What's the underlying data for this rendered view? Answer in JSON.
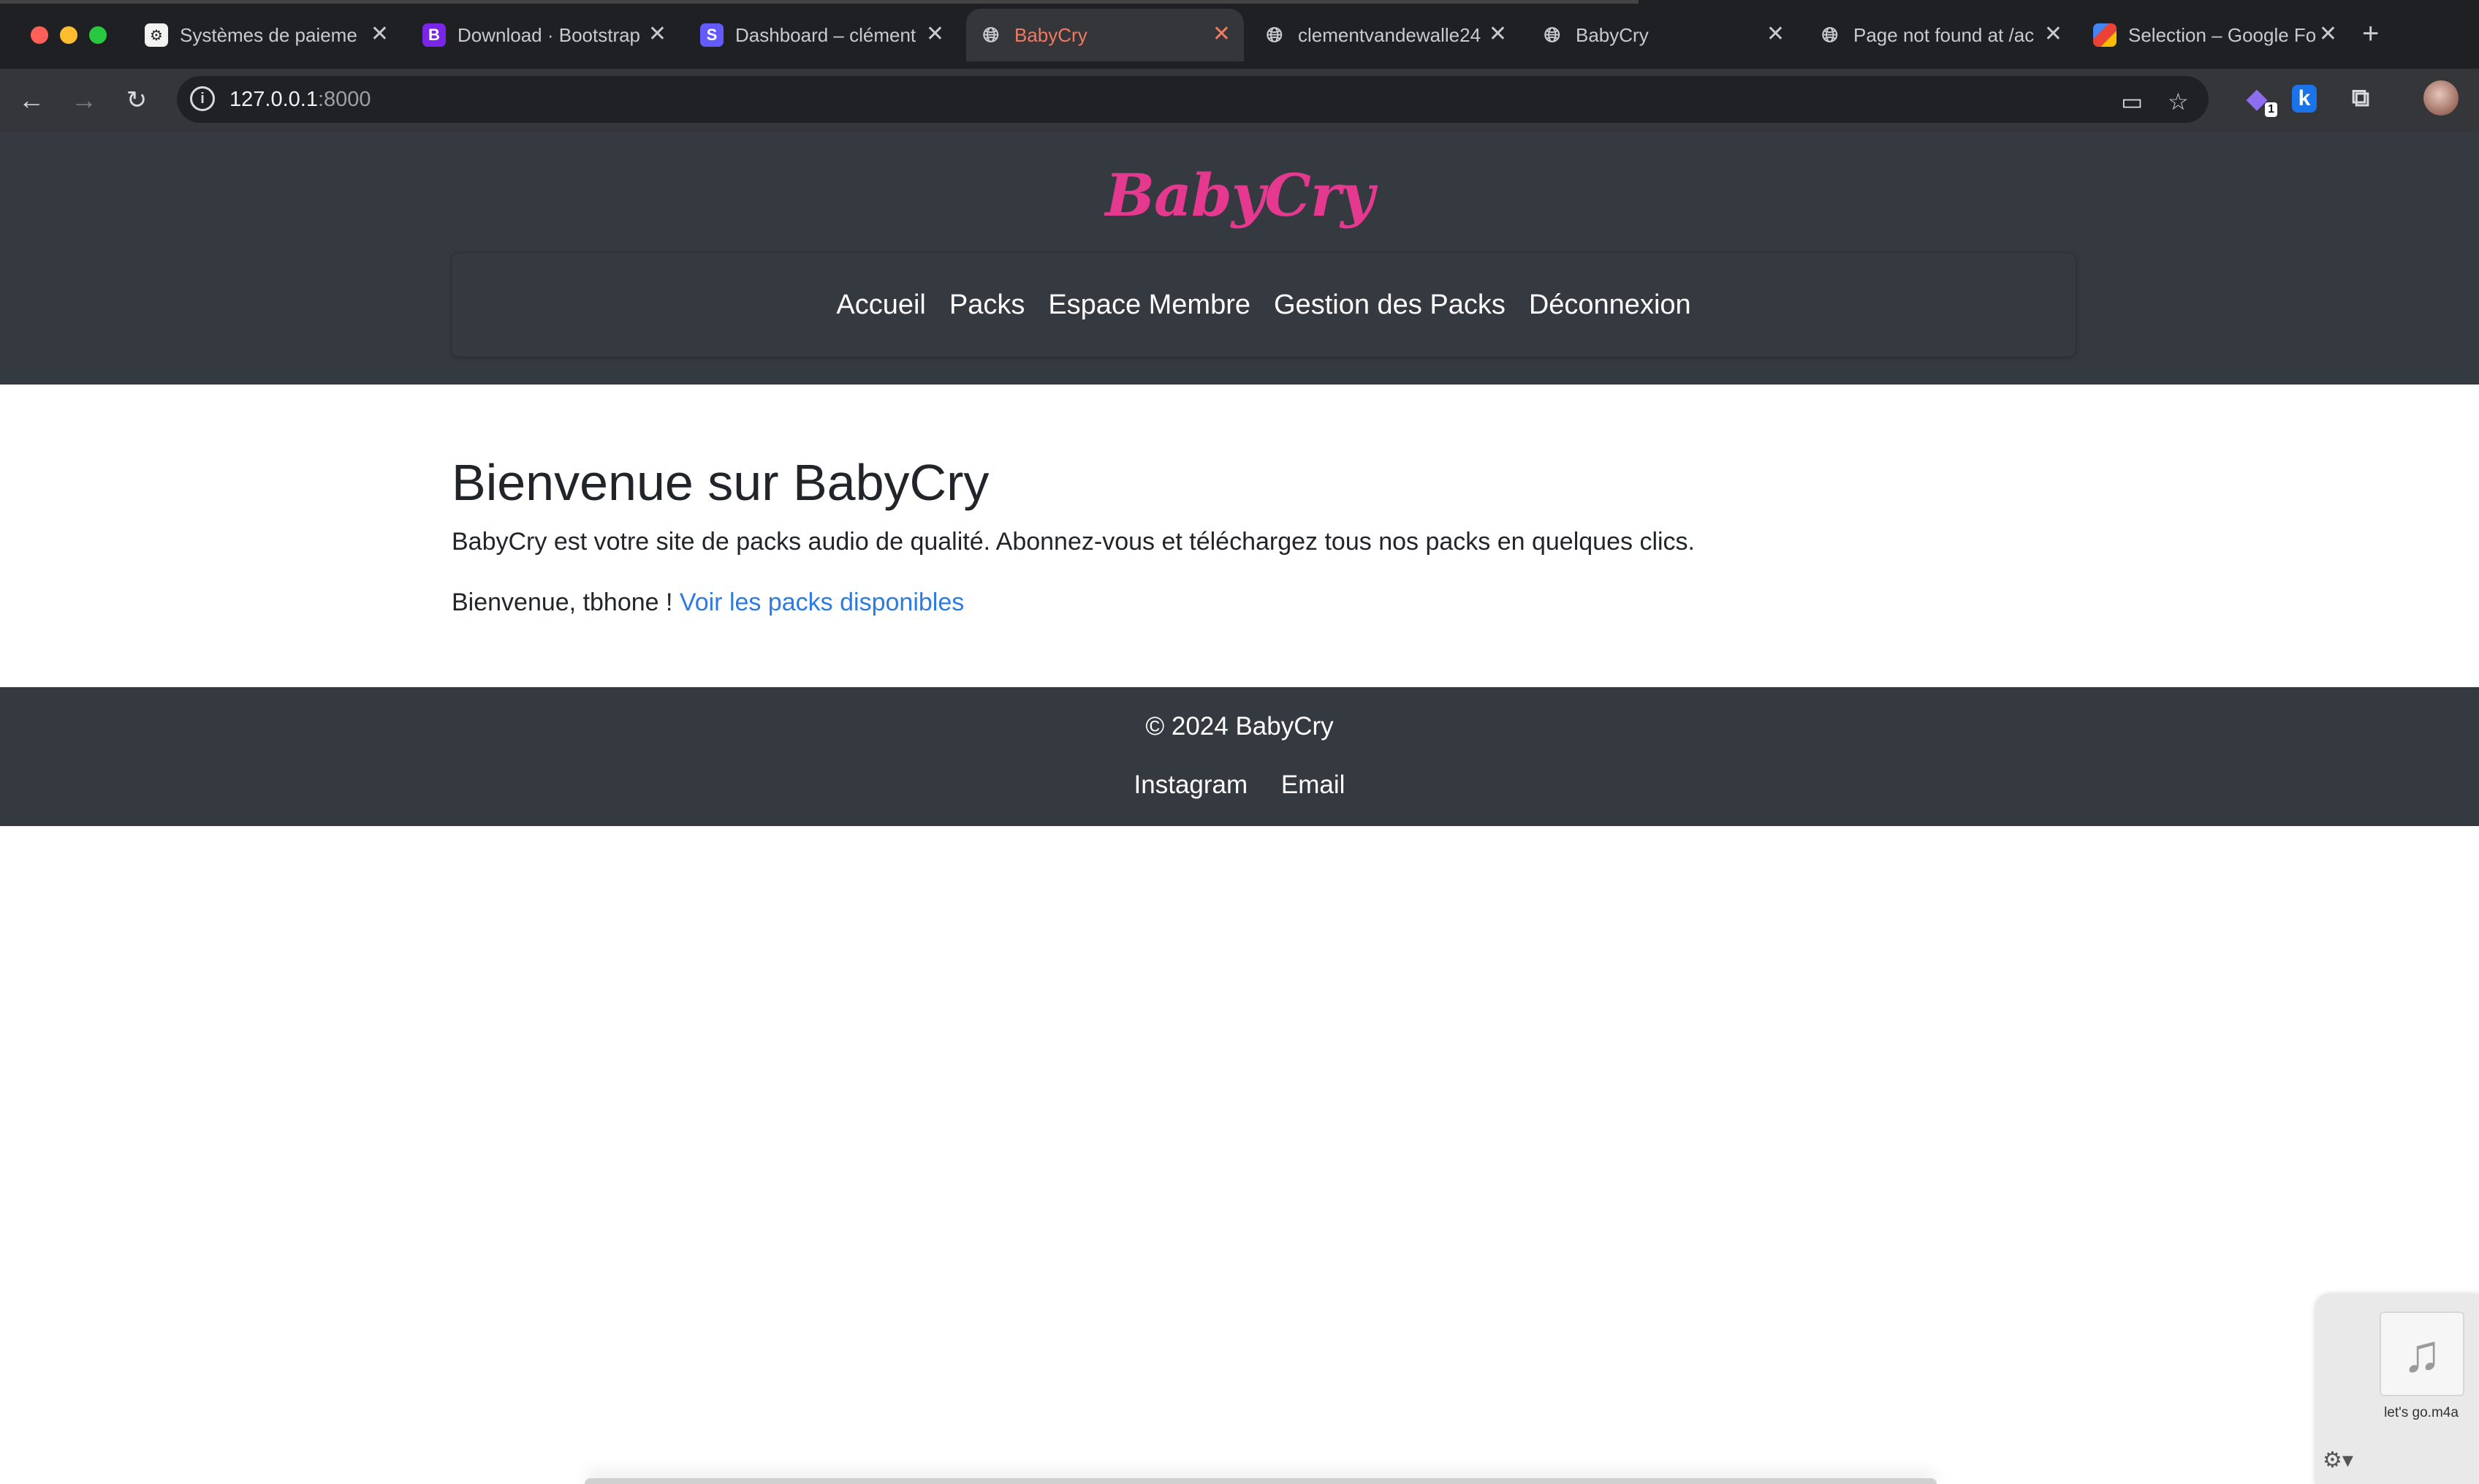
{
  "browser": {
    "tabs": [
      {
        "title": "Systèmes de paieme",
        "icon": "openai-icon",
        "active": false
      },
      {
        "title": "Download · Bootstrap",
        "icon": "bootstrap-icon",
        "active": false
      },
      {
        "title": "Dashboard – clément",
        "icon": "stripe-icon",
        "active": false
      },
      {
        "title": "BabyCry",
        "icon": "globe-icon",
        "active": true
      },
      {
        "title": "clementvandewalle24",
        "icon": "globe-icon",
        "active": false
      },
      {
        "title": "BabyCry",
        "icon": "globe-icon",
        "active": false
      },
      {
        "title": "Page not found at /ac",
        "icon": "globe-icon",
        "active": false
      },
      {
        "title": "Selection – Google Fo",
        "icon": "google-fonts-icon",
        "active": false
      }
    ],
    "address": {
      "host": "127.0.0.1",
      "port": ":8000"
    },
    "extension_badge": "1",
    "extension_k": "k"
  },
  "site": {
    "logo": "BabyCry",
    "nav": [
      "Accueil",
      "Packs",
      "Espace Membre",
      "Gestion des Packs",
      "Déconnexion"
    ]
  },
  "main": {
    "heading": "Bienvenue sur BabyCry",
    "intro": "BabyCry est votre site de packs audio de qualité. Abonnez-vous et téléchargez tous nos packs en quelques clics.",
    "welcome_text": "Bienvenue, tbhone ! ",
    "welcome_link": "Voir les packs disponibles"
  },
  "footer": {
    "copyright": "© 2024 BabyCry",
    "links": [
      "Instagram",
      "Email"
    ]
  },
  "download": {
    "filename": "let's go.m4a"
  },
  "colors": {
    "brand_pink": "#e5388f",
    "header_bg": "#343a40",
    "link_blue": "#2c7be5",
    "active_tab_text": "#f07a62"
  }
}
